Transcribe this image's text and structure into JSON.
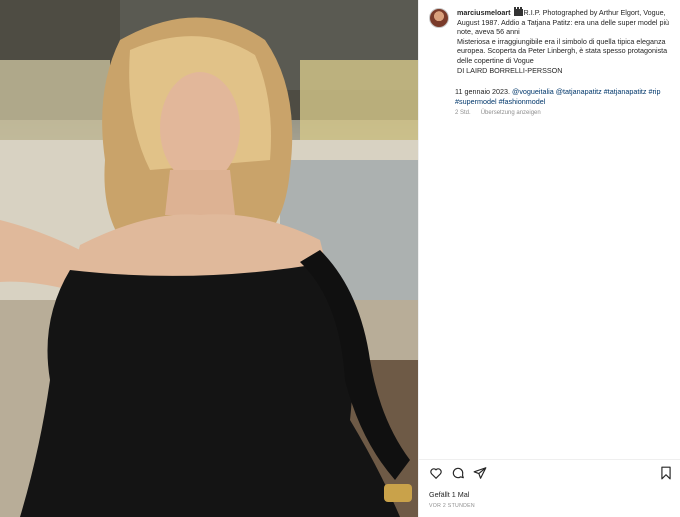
{
  "post": {
    "username": "marciusmeloart",
    "caption_lines": [
      "R.I.P. Photographed by Arthur Elgort, Vogue, August 1987. Addio a Tatjana Patitz: era una delle super model più note, aveva 56 anni",
      "Misteriosa e irraggiungibile era il simbolo di quella tipica eleganza europea. Scoperta da Peter Linbergh, è stata spesso protagonista delle copertine di Vogue",
      "DI LAIRD BORRELLI-PERSSON"
    ],
    "date_prefix": "11 gennaio 2023. ",
    "hashtags": [
      "@vogueitalia",
      "@tatjanapatitz",
      "#tatjanapatitz",
      "#rip",
      "#supermodel",
      "#fashionmodel"
    ],
    "age": "2 Std.",
    "translate_label": "Übersetzung anzeigen",
    "likes_label": "Gefällt 1 Mal",
    "timestamp": "VOR 2 STUNDEN"
  },
  "icons": {
    "like": "heart-icon",
    "comment": "comment-icon",
    "share": "share-icon",
    "save": "bookmark-icon",
    "clapper": "clapperboard-icon"
  },
  "colors": {
    "link": "#00376b",
    "muted": "#8e8e8e",
    "text": "#262626"
  }
}
